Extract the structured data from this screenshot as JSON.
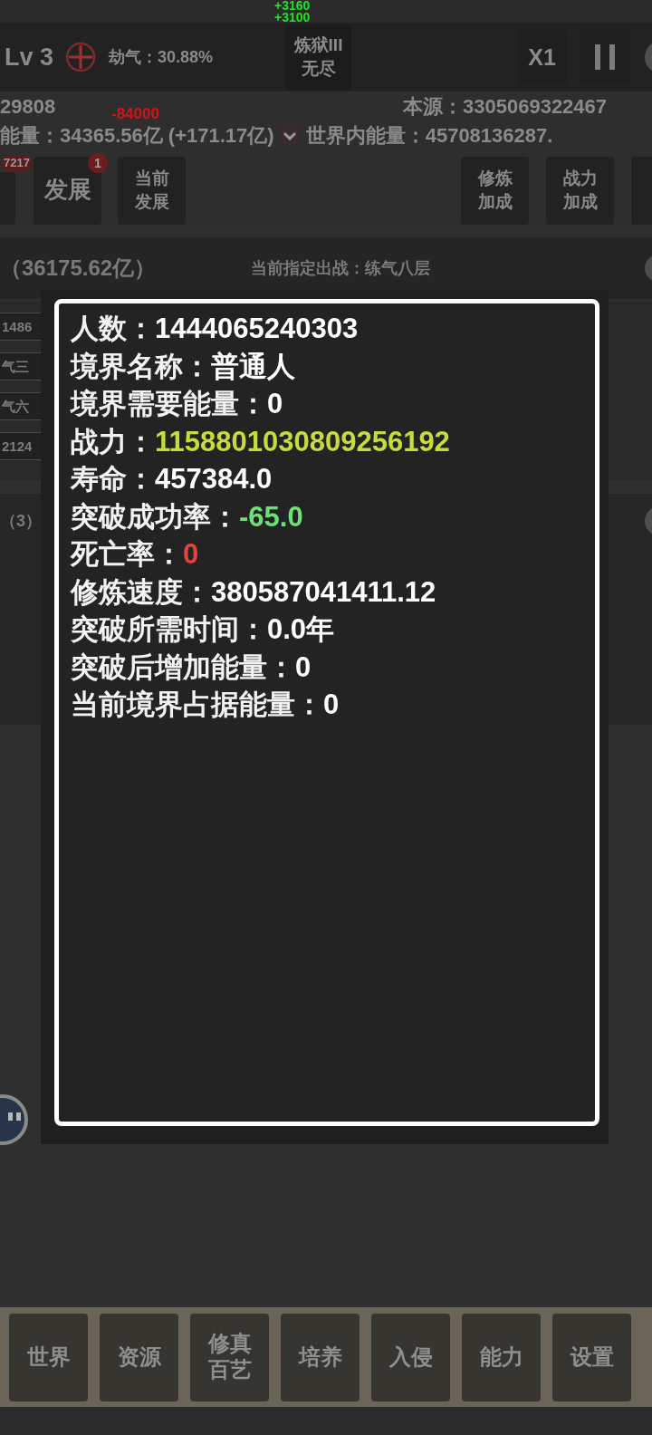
{
  "floating_numbers": [
    "+3160",
    "+3100"
  ],
  "header": {
    "level": "Lv 3",
    "stat": "劫气：30.88%",
    "mode_button": {
      "lines": [
        "炼狱III",
        "无尽"
      ]
    },
    "speed_button": "X1"
  },
  "resources": {
    "value": "29808",
    "change": "-84000",
    "source": "本源：3305069322467",
    "energy": "能量：34365.56亿 (+171.17亿)",
    "world_energy": "世界内能量：45708136287."
  },
  "left_buttons": [
    {
      "kind": "edge",
      "badge": "7217"
    },
    {
      "kind": "full",
      "lines": [
        "发展"
      ],
      "badge": "1"
    },
    {
      "kind": "full",
      "lines": [
        "当前",
        "发展"
      ]
    }
  ],
  "right_buttons": [
    {
      "kind": "full",
      "lines": [
        "修炼",
        "加成"
      ]
    },
    {
      "kind": "full",
      "lines": [
        "战力",
        "加成"
      ]
    },
    {
      "kind": "edge"
    }
  ],
  "battle_row": {
    "total": "（36175.62亿）",
    "assigned": "当前指定出战：练气八层"
  },
  "list_cells": [
    "1486",
    "气三",
    "气六",
    "2124"
  ],
  "count": "（3）",
  "details": {
    "rows": [
      {
        "label": "人数：",
        "value": "1444065240303",
        "color": "#ffffff"
      },
      {
        "label": "境界名称：",
        "value": "普通人",
        "color": "#ffffff"
      },
      {
        "label": "境界需要能量：",
        "value": "0",
        "color": "#ffffff"
      },
      {
        "label": "战力：",
        "value": "1158801030809256192",
        "color": "#c6dc3c"
      },
      {
        "label": "寿命：",
        "value": "457384.0",
        "color": "#ffffff"
      },
      {
        "label": "突破成功率：",
        "value": "-65.0",
        "color": "#6ee07a"
      },
      {
        "label": "死亡率：",
        "value": "0",
        "color": "#e8413a"
      },
      {
        "label": "修炼速度：",
        "value": "380587041411.12",
        "color": "#ffffff"
      },
      {
        "label": "突破所需时间：",
        "value": "0.0年",
        "color": "#ffffff"
      },
      {
        "label": "突破后增加能量：",
        "value": "0",
        "color": "#ffffff"
      },
      {
        "label": "当前境界占据能量：",
        "value": "0",
        "color": "#ffffff"
      }
    ]
  },
  "nav": [
    "世界",
    "资源",
    "修真百艺",
    "培养",
    "入侵",
    "能力",
    "设置"
  ]
}
